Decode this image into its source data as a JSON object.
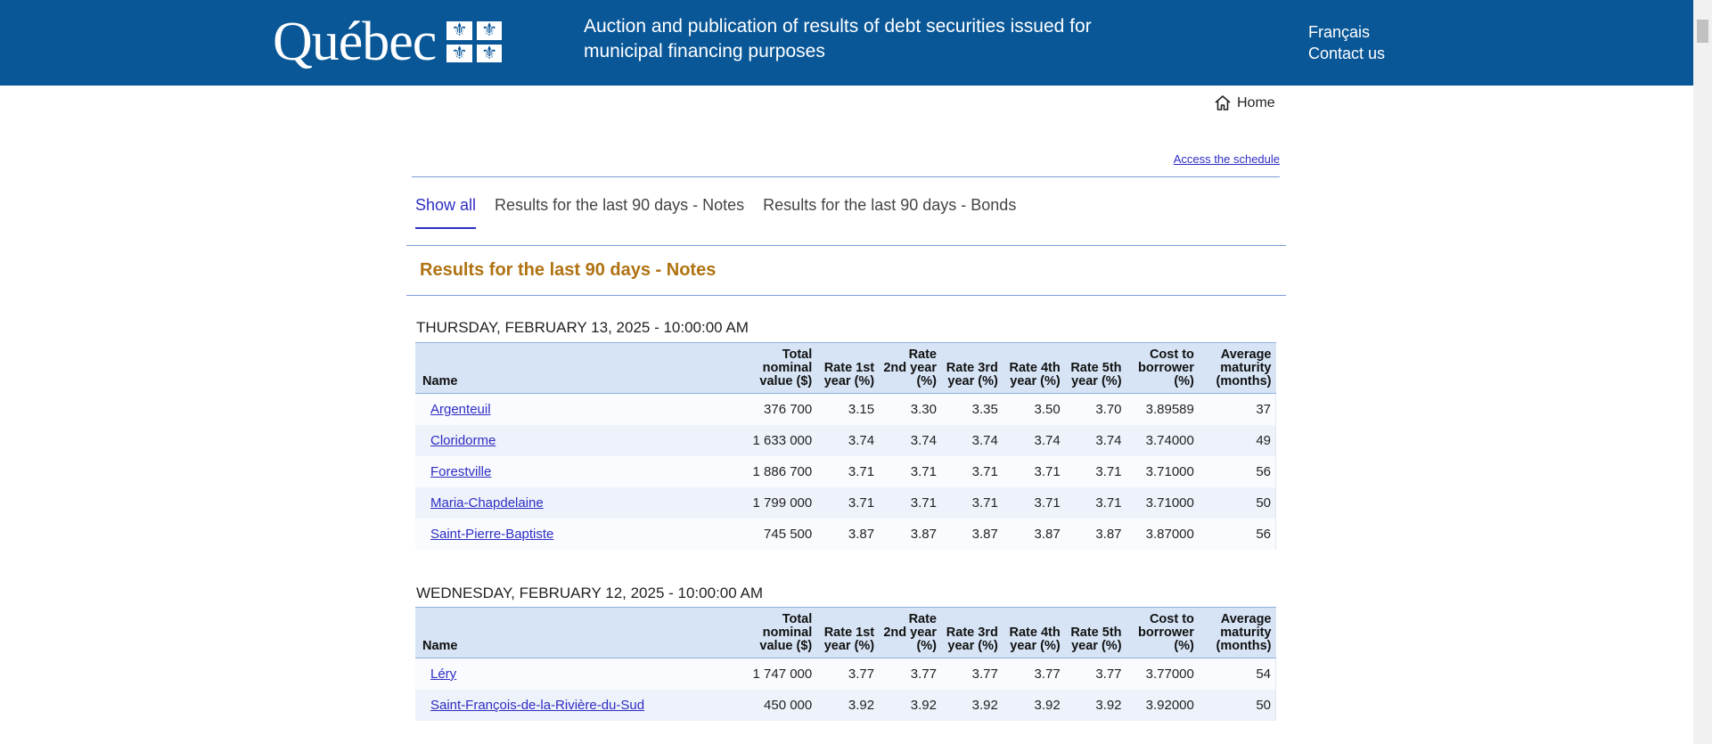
{
  "header": {
    "logo_text": "Québec",
    "site_title": "Auction and publication of results of debt securities issued for municipal financing purposes",
    "links": [
      "Français",
      "Contact us"
    ]
  },
  "nav": {
    "home": "Home",
    "access_schedule": "Access the schedule"
  },
  "tabs": [
    {
      "label": "Show all",
      "active": true
    },
    {
      "label": "Results for the last 90 days - Notes",
      "active": false
    },
    {
      "label": "Results for the last 90 days - Bonds",
      "active": false
    }
  ],
  "section_title": "Results for the last 90 days - Notes",
  "columns": [
    "Name",
    "Total nominal value ($)",
    "Rate 1st year (%)",
    "Rate 2nd year (%)",
    "Rate 3rd year (%)",
    "Rate 4th year (%)",
    "Rate 5th year (%)",
    "Cost to borrower (%)",
    "Average maturity (months)"
  ],
  "auctions": [
    {
      "date": "THURSDAY, FEBRUARY 13, 2025 - 10:00:00 AM",
      "rows": [
        [
          "Argenteuil",
          "376 700",
          "3.15",
          "3.30",
          "3.35",
          "3.50",
          "3.70",
          "3.89589",
          "37"
        ],
        [
          "Cloridorme",
          "1 633 000",
          "3.74",
          "3.74",
          "3.74",
          "3.74",
          "3.74",
          "3.74000",
          "49"
        ],
        [
          "Forestville",
          "1 886 700",
          "3.71",
          "3.71",
          "3.71",
          "3.71",
          "3.71",
          "3.71000",
          "56"
        ],
        [
          "Maria-Chapdelaine",
          "1 799 000",
          "3.71",
          "3.71",
          "3.71",
          "3.71",
          "3.71",
          "3.71000",
          "50"
        ],
        [
          "Saint-Pierre-Baptiste",
          "745 500",
          "3.87",
          "3.87",
          "3.87",
          "3.87",
          "3.87",
          "3.87000",
          "56"
        ]
      ]
    },
    {
      "date": "WEDNESDAY, FEBRUARY 12, 2025 - 10:00:00 AM",
      "rows": [
        [
          "Léry",
          "1 747 000",
          "3.77",
          "3.77",
          "3.77",
          "3.77",
          "3.77",
          "3.77000",
          "54"
        ],
        [
          "Saint-François-de-la-Rivière-du-Sud",
          "450 000",
          "3.92",
          "3.92",
          "3.92",
          "3.92",
          "3.92",
          "3.92000",
          "50"
        ]
      ]
    }
  ]
}
